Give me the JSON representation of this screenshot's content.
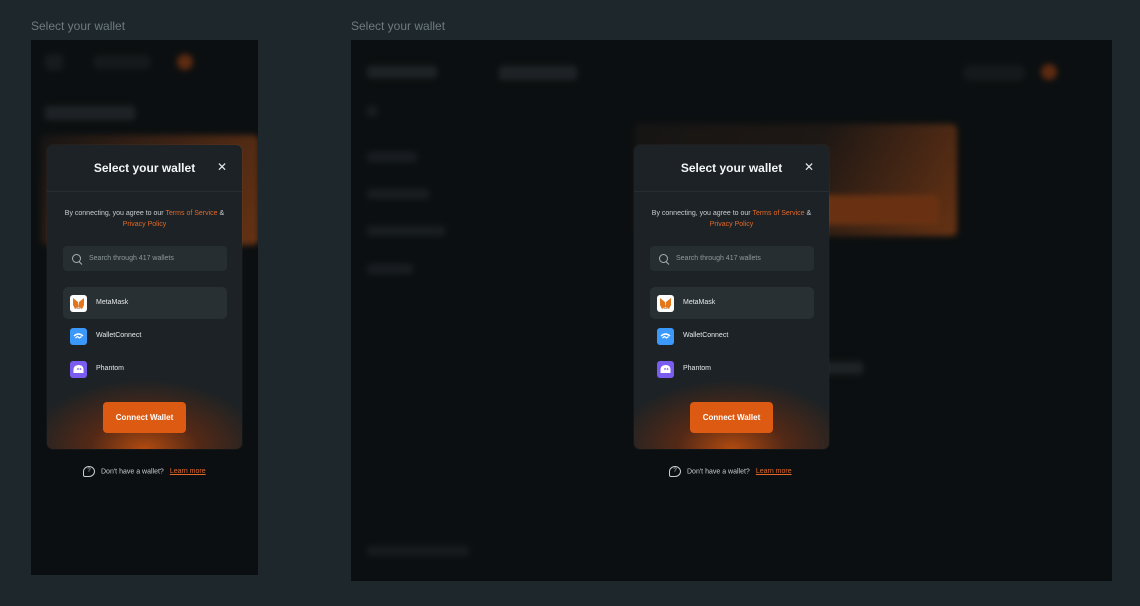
{
  "frames": {
    "mobile_label": "Select your wallet",
    "desktop_label": "Select your wallet"
  },
  "modal": {
    "title": "Select your wallet",
    "close_icon": "close-icon",
    "terms_prefix": "By connecting, you agree to our ",
    "terms_link": "Terms of Service",
    "terms_and": " & ",
    "privacy_link": "Privacy Policy",
    "search_placeholder": "Search through 417 wallets",
    "wallets": [
      {
        "name": "MetaMask",
        "icon": "metamask-icon",
        "color": "#ffffff",
        "selected": true
      },
      {
        "name": "WalletConnect",
        "icon": "walletconnect-icon",
        "color": "#3b99fc",
        "selected": false
      },
      {
        "name": "Phantom",
        "icon": "phantom-icon",
        "color": "#7a5cf0",
        "selected": false
      }
    ],
    "connect_label": "Connect Wallet"
  },
  "help": {
    "text": "Don't have a wallet?",
    "link": "Learn more"
  },
  "colors": {
    "accent": "#dd5a12",
    "link": "#e2692a",
    "background": "#1e272b",
    "modal": "#1c2225"
  }
}
